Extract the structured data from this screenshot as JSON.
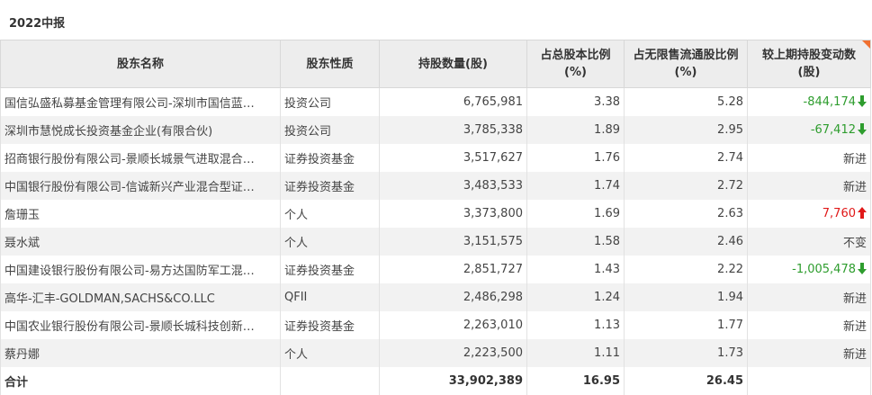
{
  "period_title": "2022中报",
  "colors": {
    "header_bg": "#ededed",
    "row_alt_bg": "#f2f2f2",
    "decrease": "#2e9d2e",
    "increase": "#e01818",
    "corner_accent": "#f07030"
  },
  "table": {
    "headers": {
      "name": "股东名称",
      "nature": "股东性质",
      "shares": "持股数量(股)",
      "pct_total": "占总股本比例(%)",
      "pct_float": "占无限售流通股比例(%)",
      "change": "较上期持股变动数(股)"
    },
    "rows": [
      {
        "name": "国信弘盛私募基金管理有限公司-深圳市国信蓝…",
        "nature": "投资公司",
        "shares": "6,765,981",
        "pct_total": "3.38",
        "pct_float": "5.28",
        "change": "-844,174",
        "direction": "down",
        "icon": "arrow-down-icon"
      },
      {
        "name": "深圳市慧悦成长投资基金企业(有限合伙)",
        "nature": "投资公司",
        "shares": "3,785,338",
        "pct_total": "1.89",
        "pct_float": "2.95",
        "change": "-67,412",
        "direction": "down",
        "icon": "arrow-down-icon"
      },
      {
        "name": "招商银行股份有限公司-景顺长城景气进取混合…",
        "nature": "证券投资基金",
        "shares": "3,517,627",
        "pct_total": "1.76",
        "pct_float": "2.74",
        "change": "新进",
        "direction": "none",
        "icon": ""
      },
      {
        "name": "中国银行股份有限公司-信诚新兴产业混合型证…",
        "nature": "证券投资基金",
        "shares": "3,483,533",
        "pct_total": "1.74",
        "pct_float": "2.72",
        "change": "新进",
        "direction": "none",
        "icon": ""
      },
      {
        "name": "詹珊玉",
        "nature": "个人",
        "shares": "3,373,800",
        "pct_total": "1.69",
        "pct_float": "2.63",
        "change": "7,760",
        "direction": "up",
        "icon": "arrow-up-icon"
      },
      {
        "name": "聂水斌",
        "nature": "个人",
        "shares": "3,151,575",
        "pct_total": "1.58",
        "pct_float": "2.46",
        "change": "不变",
        "direction": "none",
        "icon": ""
      },
      {
        "name": "中国建设银行股份有限公司-易方达国防军工混…",
        "nature": "证券投资基金",
        "shares": "2,851,727",
        "pct_total": "1.43",
        "pct_float": "2.22",
        "change": "-1,005,478",
        "direction": "down",
        "icon": "arrow-down-icon"
      },
      {
        "name": "高华-汇丰-GOLDMAN,SACHS&CO.LLC",
        "nature": "QFII",
        "shares": "2,486,298",
        "pct_total": "1.24",
        "pct_float": "1.94",
        "change": "新进",
        "direction": "none",
        "icon": ""
      },
      {
        "name": "中国农业银行股份有限公司-景顺长城科技创新…",
        "nature": "证券投资基金",
        "shares": "2,263,010",
        "pct_total": "1.13",
        "pct_float": "1.77",
        "change": "新进",
        "direction": "none",
        "icon": ""
      },
      {
        "name": "蔡丹娜",
        "nature": "个人",
        "shares": "2,223,500",
        "pct_total": "1.11",
        "pct_float": "1.73",
        "change": "新进",
        "direction": "none",
        "icon": ""
      }
    ],
    "total": {
      "label": "合计",
      "shares": "33,902,389",
      "pct_total": "16.95",
      "pct_float": "26.45"
    }
  }
}
